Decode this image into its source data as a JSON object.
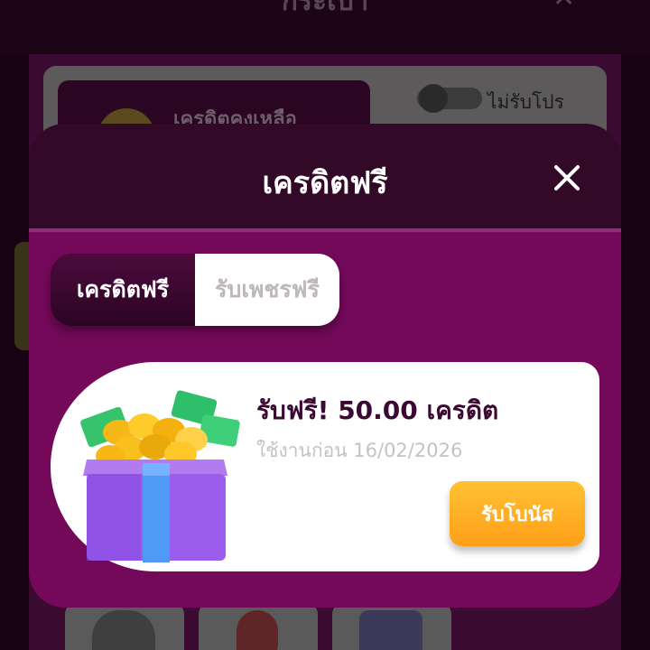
{
  "background": {
    "header_title": "กระเป๋า",
    "credit_label": "เครดิตคงเหลือ",
    "toggle_label": "ไม่รับโปร"
  },
  "modal": {
    "title": "เครดิตฟรี",
    "tabs": [
      {
        "label": "เครดิตฟรี",
        "active": true
      },
      {
        "label": "รับเพชรฟรี",
        "active": false
      }
    ],
    "promo": {
      "title": "รับฟรี! 50.00 เครดิต",
      "expiry": "ใช้งานก่อน 16/02/2026",
      "button_label": "รับโบนัส"
    }
  },
  "colors": {
    "modal_bg": "#74095a",
    "header_bg": "#330928",
    "button_orange": "#ffb224",
    "title_purple": "#3b0832"
  },
  "icons": [
    "close-icon",
    "gift-icon",
    "clock-icon",
    "location-pin-icon",
    "store-icon",
    "coin-icon"
  ]
}
